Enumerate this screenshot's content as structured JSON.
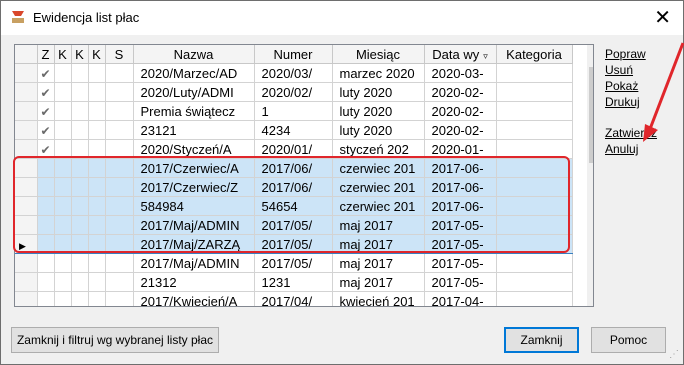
{
  "window": {
    "title": "Ewidencja list płac",
    "close_label": "✕"
  },
  "table": {
    "columns": [
      "Z",
      "K",
      "K",
      "K",
      "S",
      "Nazwa",
      "Numer",
      "Miesiąc",
      "Data wy",
      "Kategoria"
    ],
    "rows": [
      {
        "z": "✔",
        "k1": "",
        "k2": "",
        "k3": "",
        "s": "",
        "nazwa": "2020/Marzec/AD",
        "numer": "2020/03/",
        "miesiac": "marzec 2020",
        "data": "2020-03-",
        "kategoria": ""
      },
      {
        "z": "✔",
        "k1": "",
        "k2": "",
        "k3": "",
        "s": "",
        "nazwa": "2020/Luty/ADMI",
        "numer": "2020/02/",
        "miesiac": "luty 2020",
        "data": "2020-02-",
        "kategoria": ""
      },
      {
        "z": "✔",
        "k1": "",
        "k2": "",
        "k3": "",
        "s": "",
        "nazwa": "Premia świątecz",
        "numer": "1",
        "miesiac": "luty 2020",
        "data": "2020-02-",
        "kategoria": ""
      },
      {
        "z": "✔",
        "k1": "",
        "k2": "",
        "k3": "",
        "s": "",
        "nazwa": "23121",
        "numer": "4234",
        "miesiac": "luty 2020",
        "data": "2020-02-",
        "kategoria": ""
      },
      {
        "z": "✔",
        "k1": "",
        "k2": "",
        "k3": "",
        "s": "",
        "nazwa": "2020/Styczeń/A",
        "numer": "2020/01/",
        "miesiac": "styczeń 202",
        "data": "2020-01-",
        "kategoria": ""
      },
      {
        "z": "",
        "k1": "",
        "k2": "",
        "k3": "",
        "s": "",
        "nazwa": "2017/Czerwiec/A",
        "numer": "2017/06/",
        "miesiac": "czerwiec 201",
        "data": "2017-06-",
        "kategoria": ""
      },
      {
        "z": "",
        "k1": "",
        "k2": "",
        "k3": "",
        "s": "",
        "nazwa": "2017/Czerwiec/Z",
        "numer": "2017/06/",
        "miesiac": "czerwiec 201",
        "data": "2017-06-",
        "kategoria": ""
      },
      {
        "z": "",
        "k1": "",
        "k2": "",
        "k3": "",
        "s": "",
        "nazwa": "584984",
        "numer": "54654",
        "miesiac": "czerwiec 201",
        "data": "2017-06-",
        "kategoria": ""
      },
      {
        "z": "",
        "k1": "",
        "k2": "",
        "k3": "",
        "s": "",
        "nazwa": "2017/Maj/ADMIN",
        "numer": "2017/05/",
        "miesiac": "maj 2017",
        "data": "2017-05-",
        "kategoria": ""
      },
      {
        "z": "",
        "k1": "",
        "k2": "",
        "k3": "",
        "s": "",
        "nazwa": "2017/Maj/ZARZĄ",
        "numer": "2017/05/",
        "miesiac": "maj 2017",
        "data": "2017-05-",
        "kategoria": ""
      },
      {
        "z": "",
        "k1": "",
        "k2": "",
        "k3": "",
        "s": "",
        "nazwa": "2017/Maj/ADMIN",
        "numer": "2017/05/",
        "miesiac": "maj 2017",
        "data": "2017-05-",
        "kategoria": ""
      },
      {
        "z": "",
        "k1": "",
        "k2": "",
        "k3": "",
        "s": "",
        "nazwa": "21312",
        "numer": "1231",
        "miesiac": "maj 2017",
        "data": "2017-05-",
        "kategoria": ""
      },
      {
        "z": "",
        "k1": "",
        "k2": "",
        "k3": "",
        "s": "",
        "nazwa": "2017/Kwiecień/A",
        "numer": "2017/04/",
        "miesiac": "kwiecień 201",
        "data": "2017-04-",
        "kategoria": ""
      }
    ],
    "selected_rows": [
      5,
      6,
      7,
      8,
      9
    ],
    "current_row": 9,
    "current_row_marker": "▶",
    "sort_marker": "▿"
  },
  "actions": [
    "Popraw",
    "Usuń",
    "Pokaż",
    "Drukuj",
    "Zatwierdź",
    "Anuluj"
  ],
  "buttons": {
    "filter": "Zamknij i filtruj wg wybranej listy płac",
    "close": "Zamknij",
    "help": "Pomoc"
  },
  "colors": {
    "selection": "#cce4f7",
    "highlight_outline": "#e0262b",
    "annotation_arrow": "#e0262b",
    "default_button_border": "#0078d7"
  },
  "icons": [
    "app-icon",
    "close-icon",
    "check-icon",
    "row-pointer-icon",
    "sort-icon",
    "scroll-up-icon",
    "scroll-down-icon",
    "size-grip-icon",
    "red-arrow-icon"
  ]
}
